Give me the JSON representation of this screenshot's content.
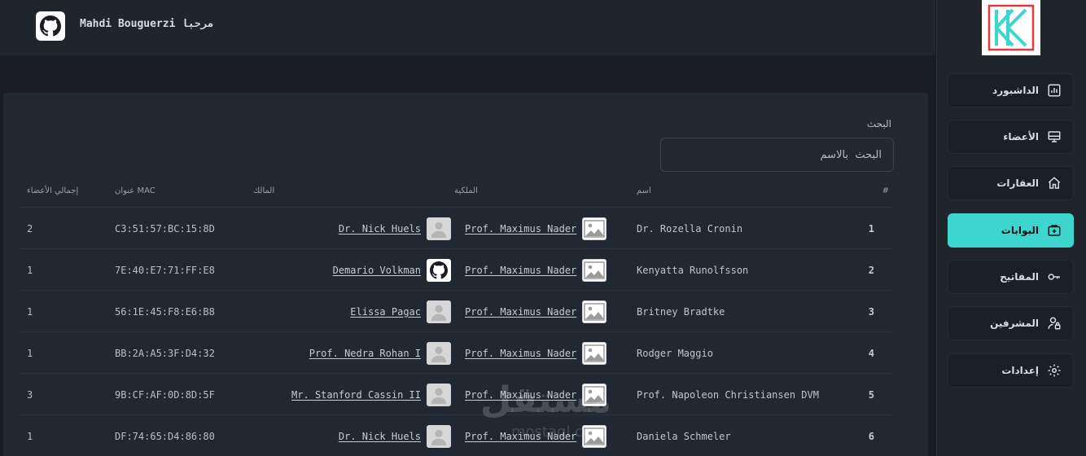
{
  "header": {
    "welcome": "مرحبا Mahdi Bouguerzi",
    "github_icon": "github-icon"
  },
  "sidebar": {
    "logo_icon": "brand-logo",
    "items": [
      {
        "label": "الداشبورد",
        "icon": "chart-icon",
        "active": false
      },
      {
        "label": "الأعضاء",
        "icon": "monitor-icon",
        "active": false
      },
      {
        "label": "العقارات",
        "icon": "home-icon",
        "active": false
      },
      {
        "label": "البوابات",
        "icon": "gate-icon",
        "active": true
      },
      {
        "label": "المفاتيح",
        "icon": "key-icon",
        "active": false
      },
      {
        "label": "المشرفين",
        "icon": "user-lock-icon",
        "active": false
      },
      {
        "label": "إعدادات",
        "icon": "gear-icon",
        "active": false
      }
    ],
    "accent": "#3dd6cf"
  },
  "search": {
    "label": "البحث",
    "placeholder": "البحث  بالاسم",
    "value": ""
  },
  "table": {
    "headers": {
      "num": "#",
      "name": "اسم",
      "ownership": "الملكية",
      "owner": "المالك",
      "mac": "عنوان MAC",
      "total": "إجمالي الأعضاء"
    },
    "rows": [
      {
        "num": "1",
        "name": "Dr. Rozella Cronin",
        "ownership": "Prof. Maximus Nader",
        "owner": "Dr. Nick Huels",
        "owner_avatar": "person",
        "mac": "C3:51:57:BC:15:8D",
        "total": "2"
      },
      {
        "num": "2",
        "name": "Kenyatta Runolfsson",
        "ownership": "Prof. Maximus Nader",
        "owner": "Demario Volkman",
        "owner_avatar": "github",
        "mac": "7E:40:E7:71:FF:E8",
        "total": "1"
      },
      {
        "num": "3",
        "name": "Britney Bradtke",
        "ownership": "Prof. Maximus Nader",
        "owner": "Elissa Pagac",
        "owner_avatar": "person",
        "mac": "56:1E:45:F8:E6:B8",
        "total": "1"
      },
      {
        "num": "4",
        "name": "Rodger Maggio",
        "ownership": "Prof. Maximus Nader",
        "owner": "Prof. Nedra Rohan I",
        "owner_avatar": "person",
        "mac": "BB:2A:A5:3F:D4:32",
        "total": "1"
      },
      {
        "num": "5",
        "name": "Prof. Napoleon Christiansen DVM",
        "ownership": "Prof. Maximus Nader",
        "owner": "Mr. Stanford Cassin II",
        "owner_avatar": "person",
        "mac": "9B:CF:AF:0D:8D:5F",
        "total": "3"
      },
      {
        "num": "6",
        "name": "Daniela Schmeler",
        "ownership": "Prof. Maximus Nader",
        "owner": "Dr. Nick Huels",
        "owner_avatar": "person",
        "mac": "DF:74:65:D4:86:80",
        "total": "1"
      }
    ]
  },
  "watermark": {
    "text": "مستقل",
    "sub": "mostaql.com"
  }
}
